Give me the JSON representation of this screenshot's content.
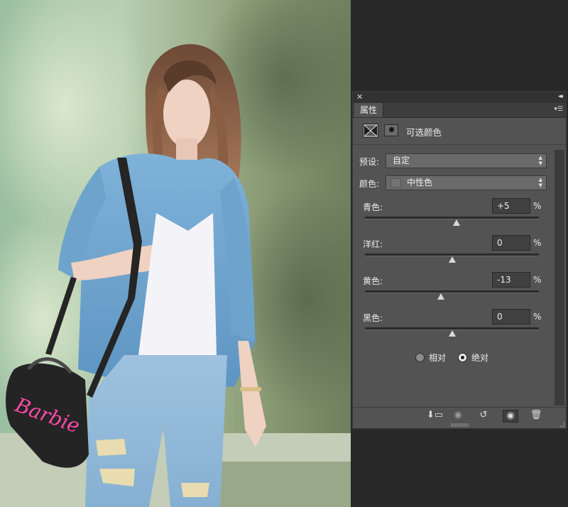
{
  "panel": {
    "tab_label": "属性",
    "adjustment_title": "可选颜色",
    "preset": {
      "label": "预设:",
      "value": "自定"
    },
    "colors": {
      "label": "颜色:",
      "value": "中性色"
    },
    "sliders": [
      {
        "label": "青色:",
        "value": "+5",
        "unit": "%",
        "level": 0.525
      },
      {
        "label": "洋红:",
        "value": "0",
        "unit": "%",
        "level": 0.5
      },
      {
        "label": "黄色:",
        "value": "-13",
        "unit": "%",
        "level": 0.435
      },
      {
        "label": "黑色:",
        "value": "0",
        "unit": "%",
        "level": 0.5
      }
    ],
    "method": {
      "relative_label": "相对",
      "absolute_label": "绝对",
      "selected": "absolute"
    }
  },
  "bottom_icons": [
    "clip-to-layer-icon",
    "view-previous-icon",
    "reset-icon",
    "visibility-eye-icon",
    "trash-icon"
  ],
  "colors_ui": {
    "panel_bg": "#535353",
    "workspace_bg": "#282828",
    "field_bg": "#6a6a6a"
  }
}
